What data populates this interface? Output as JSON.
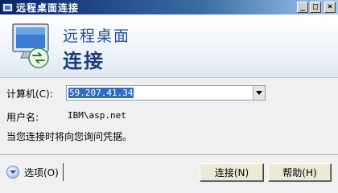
{
  "window": {
    "title": "远程桌面连接",
    "controls": [
      "_",
      "□",
      "×"
    ]
  },
  "banner": {
    "line1": "远程桌面",
    "line2": "连接",
    "logo_icon": "monitor-remote-icon"
  },
  "form": {
    "computer_label": "计算机(C):",
    "computer_value": "59.207.41.34",
    "username_label": "用户名:",
    "username_value": "IBM\\asp.net",
    "credentials_note": "当您连接时将向您询问凭据。"
  },
  "footer": {
    "options_label": "选项(O)",
    "connect_label": "连接(N)",
    "help_label": "帮助(H)"
  }
}
